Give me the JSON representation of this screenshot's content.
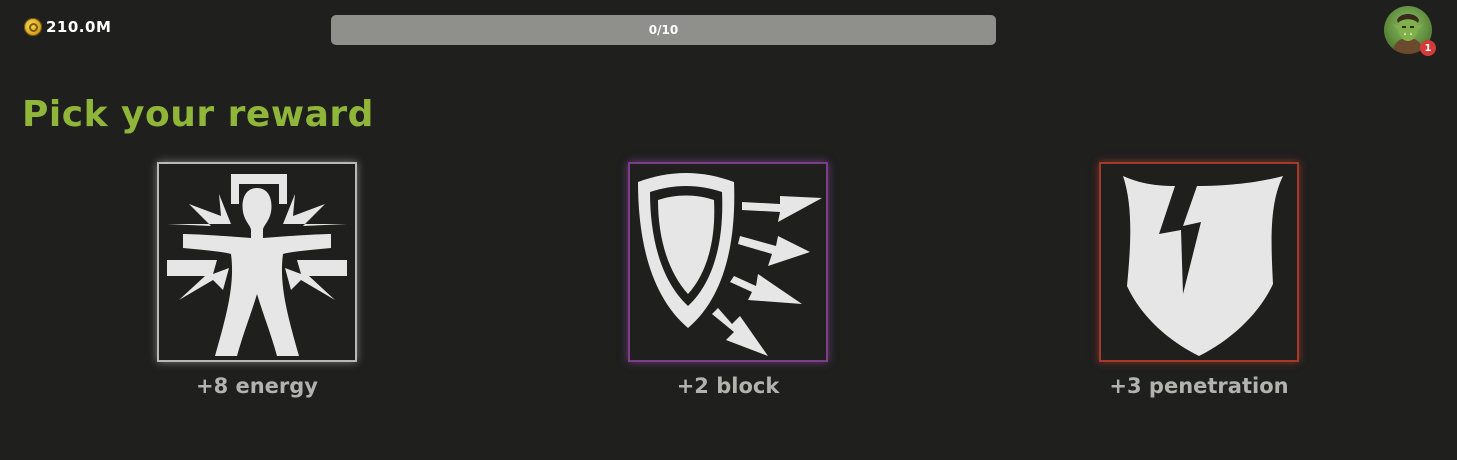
{
  "header": {
    "gold_amount": "210.0M",
    "progress": {
      "text": "0/10",
      "value": 0,
      "max": 10
    },
    "avatar": {
      "notification_count": "1"
    }
  },
  "main": {
    "heading": "Pick your reward",
    "rewards": [
      {
        "label": "+8 energy",
        "icon": "energy-icon",
        "frame_color": "#b8b8b6"
      },
      {
        "label": "+2 block",
        "icon": "block-icon",
        "frame_color": "#7b3f8a"
      },
      {
        "label": "+3 penetration",
        "icon": "penetration-icon",
        "frame_color": "#a33a2a"
      }
    ]
  },
  "colors": {
    "accent": "#8fb539",
    "background": "#1f1f1e",
    "progress_track": "#8f908b",
    "label": "#b2b2ae",
    "notification": "#d33a3a"
  }
}
